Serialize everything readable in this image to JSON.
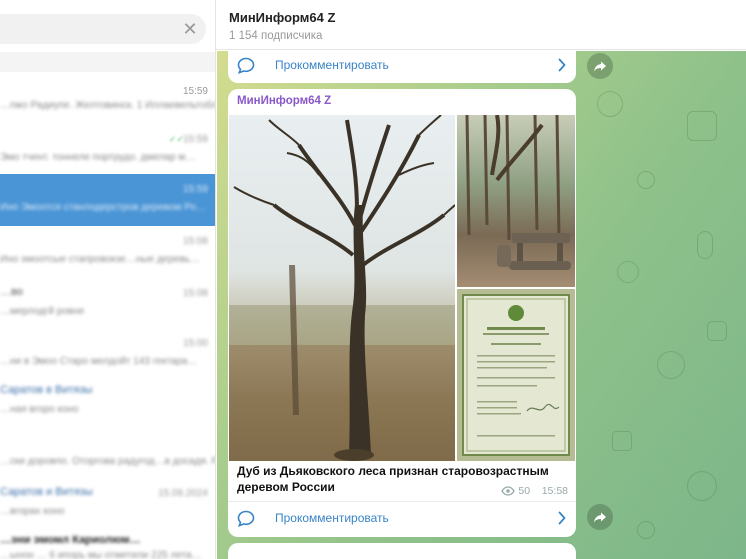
{
  "sidebar": {
    "search_clear": "✕",
    "chats": [
      {
        "time": "15:59",
        "line1": "",
        "line2": "…пжо Радиупе. Желтовинск. 1 Иллаевельтоблб"
      },
      {
        "time": "15:59",
        "line1": "",
        "line2": "Эмо тчент. тоннеле портрудо. дмелар м…"
      },
      {
        "time": "15:59",
        "line1": "",
        "line2": "Ино Эмоотся станлодерстров деревом Ро…"
      },
      {
        "time": "15:08",
        "line1": "",
        "line2": "Ино эмоотсые стапровокзе…ные деревь…"
      },
      {
        "time": "15:08",
        "line1": "…во",
        "line2": "…мерлодгй ровне"
      },
      {
        "time": "15:00",
        "line1": "",
        "line2": "…ни в Эмоо Старо мелдойт 143 гектара…"
      },
      {
        "time": "",
        "line1": "Саратов в Витязы",
        "line2": "…ная вгоро коно"
      },
      {
        "time": "",
        "line1": "",
        "line2": "…ски доровпо. Оторгова радугод…в досадя. Ро…"
      },
      {
        "time": "15.09.2024",
        "line1": "Саратов и Витязы",
        "line2": "…вгорах коно"
      },
      {
        "time": "",
        "line1": "…эни эмомл Кариолюм…",
        "line2": "…ынон … 6 ипорь мы отметили 225 лета…"
      }
    ]
  },
  "header": {
    "title": "МинИнформ64 Z",
    "subscribers": "1 154 подписчика"
  },
  "posts": [
    {
      "comment_label": "Прокомментировать"
    },
    {
      "author": "МинИнформ64 Z",
      "text": "Дуб из Дьяковского леса признан старовозрастным деревом России",
      "views": "50",
      "time": "15:58",
      "comment_label": "Прокомментировать"
    }
  ],
  "colors": {
    "accent": "#3a84c6",
    "author": "#8a58c8",
    "active_chat": "#4a95d6"
  },
  "icons": [
    "close-icon",
    "comment-icon",
    "chevron-right-icon",
    "share-icon",
    "eye-icon"
  ]
}
